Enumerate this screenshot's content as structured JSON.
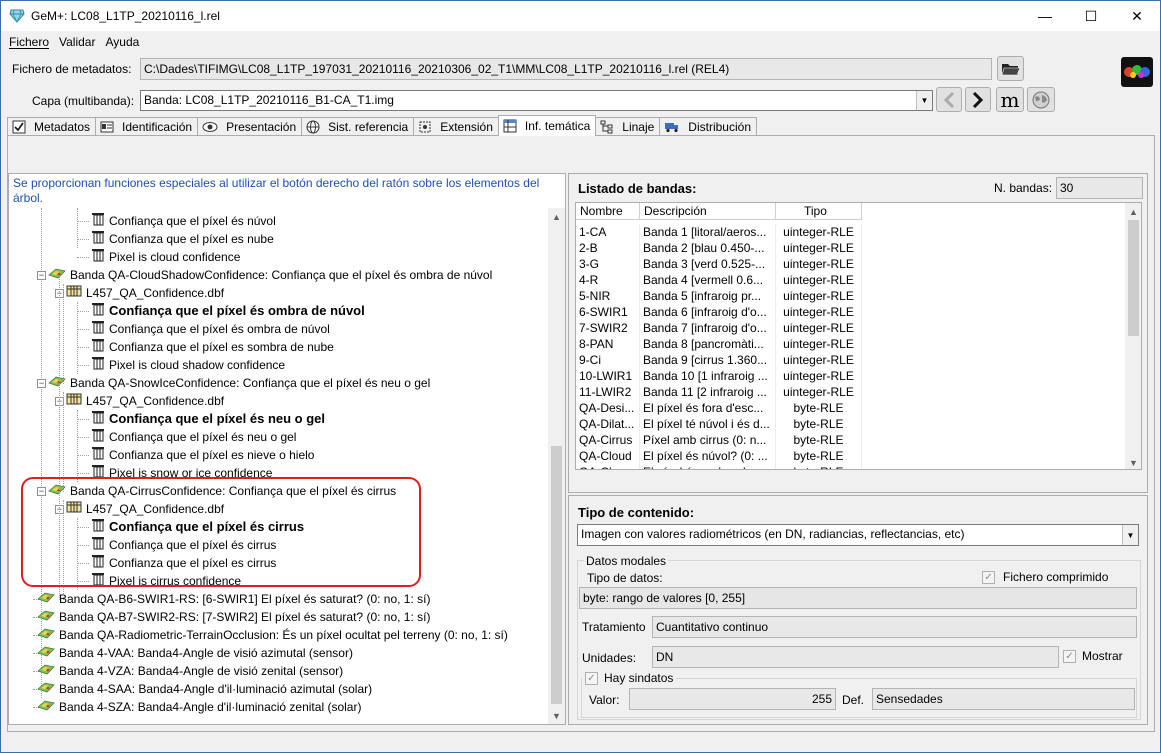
{
  "window": {
    "title": "GeM+: LC08_L1TP_20210116_l.rel",
    "minimize": "—",
    "maximize": "☐",
    "close": "✕"
  },
  "menu": [
    "Fichero",
    "Validar",
    "Ayuda"
  ],
  "metadata_file": {
    "label": "Fichero de metadatos:",
    "value": "C:\\Dades\\TIFIMG\\LC08_L1TP_197031_20210116_20210306_02_T1\\MM\\LC08_L1TP_20210116_l.rel (REL4)"
  },
  "layer": {
    "label": "Capa (multibanda):",
    "value": "Banda: LC08_L1TP_20210116_B1-CA_T1.img"
  },
  "tabs": [
    {
      "label": "Metadatos",
      "icon": "check-edit-icon"
    },
    {
      "label": "Identificación",
      "icon": "id-card-icon"
    },
    {
      "label": "Presentación",
      "icon": "eye-icon"
    },
    {
      "label": "Sist. referencia",
      "icon": "globe-icon"
    },
    {
      "label": "Extensión",
      "icon": "extent-icon"
    },
    {
      "label": "Inf. temática",
      "icon": "table-icon"
    },
    {
      "label": "Linaje",
      "icon": "tree-icon"
    },
    {
      "label": "Distribución",
      "icon": "truck-icon"
    }
  ],
  "tree": {
    "hint": "Se proporcionan funciones especiales al utilizar el botón derecho del ratón sobre los elementos del árbol.",
    "nodes": [
      {
        "text": "Confiança que el píxel és núvol",
        "level": 3,
        "bold": false
      },
      {
        "text": "Confianza que el píxel es nube",
        "level": 3,
        "bold": false
      },
      {
        "text": "Pixel is cloud confidence",
        "level": 3,
        "bold": false
      },
      {
        "text": "Banda QA-CloudShadowConfidence: Confiança que el píxel és ombra de núvol",
        "level": 1,
        "bold": false
      },
      {
        "text": "L457_QA_Confidence.dbf",
        "level": 2,
        "bold": false
      },
      {
        "text": "Confiança que el píxel és ombra de núvol",
        "level": 3,
        "bold": true
      },
      {
        "text": "Confiança que el píxel és ombra de núvol",
        "level": 3,
        "bold": false
      },
      {
        "text": "Confianza que el píxel es sombra de nube",
        "level": 3,
        "bold": false
      },
      {
        "text": "Pixel is cloud shadow confidence",
        "level": 3,
        "bold": false
      },
      {
        "text": "Banda QA-SnowIceConfidence: Confiança que el píxel és neu o gel",
        "level": 1,
        "bold": false
      },
      {
        "text": "L457_QA_Confidence.dbf",
        "level": 2,
        "bold": false
      },
      {
        "text": "Confiança que el píxel és neu o gel",
        "level": 3,
        "bold": true
      },
      {
        "text": "Confiança que el píxel és neu o gel",
        "level": 3,
        "bold": false
      },
      {
        "text": "Confianza que el píxel es nieve o hielo",
        "level": 3,
        "bold": false
      },
      {
        "text": "Pixel is snow or ice confidence",
        "level": 3,
        "bold": false
      },
      {
        "text": "Banda QA-CirrusConfidence: Confiança que el píxel és cirrus",
        "level": 1,
        "bold": false
      },
      {
        "text": "L457_QA_Confidence.dbf",
        "level": 2,
        "bold": false
      },
      {
        "text": "Confiança que el píxel és cirrus",
        "level": 3,
        "bold": true
      },
      {
        "text": "Confiança que el píxel és cirrus",
        "level": 3,
        "bold": false
      },
      {
        "text": "Confianza que el píxel es cirrus",
        "level": 3,
        "bold": false
      },
      {
        "text": "Pixel is cirrus confidence",
        "level": 3,
        "bold": false
      },
      {
        "text": "Banda QA-B6-SWIR1-RS: [6-SWIR1] El píxel és saturat? (0: no, 1: sí)",
        "level": 1,
        "bold": false
      },
      {
        "text": "Banda QA-B7-SWIR2-RS: [7-SWIR2] El píxel és saturat? (0: no, 1: sí)",
        "level": 1,
        "bold": false
      },
      {
        "text": "Banda QA-Radiometric-TerrainOcclusion: És un píxel ocultat pel terreny (0: no, 1: sí)",
        "level": 1,
        "bold": false
      },
      {
        "text": "Banda 4-VAA: Banda4-Angle de visió azimutal (sensor)",
        "level": 1,
        "bold": false
      },
      {
        "text": "Banda 4-VZA: Banda4-Angle de visió zenital (sensor)",
        "level": 1,
        "bold": false
      },
      {
        "text": "Banda 4-SAA: Banda4-Angle d'il·luminació azimutal (solar)",
        "level": 1,
        "bold": false
      },
      {
        "text": "Banda 4-SZA: Banda4-Angle d'il·luminació zenital (solar)",
        "level": 1,
        "bold": false
      }
    ]
  },
  "bands": {
    "title": "Listado de bandas:",
    "count_label": "N. bandas:",
    "count": "30",
    "headers": [
      "Nombre",
      "Descripción",
      "Tipo"
    ],
    "rows": [
      [
        "1-CA",
        "Banda 1 [litoral/aeros...",
        "uinteger-RLE"
      ],
      [
        "2-B",
        "Banda 2 [blau 0.450-...",
        "uinteger-RLE"
      ],
      [
        "3-G",
        "Banda 3 [verd 0.525-...",
        "uinteger-RLE"
      ],
      [
        "4-R",
        "Banda 4 [vermell 0.6...",
        "uinteger-RLE"
      ],
      [
        "5-NIR",
        "Banda 5 [infraroig pr...",
        "uinteger-RLE"
      ],
      [
        "6-SWIR1",
        "Banda 6 [infraroig d'o...",
        "uinteger-RLE"
      ],
      [
        "7-SWIR2",
        "Banda 7 [infraroig d'o...",
        "uinteger-RLE"
      ],
      [
        "8-PAN",
        "Banda 8 [pancromàti...",
        "uinteger-RLE"
      ],
      [
        "9-Ci",
        "Banda 9 [cirrus 1.360...",
        "uinteger-RLE"
      ],
      [
        "10-LWIR1",
        "Banda 10 [1 infraroig ...",
        "uinteger-RLE"
      ],
      [
        "11-LWIR2",
        "Banda 11 [2 infraroig ...",
        "uinteger-RLE"
      ],
      [
        "QA-Desi...",
        "El píxel és fora d'esc...",
        "byte-RLE"
      ],
      [
        "QA-Dilat...",
        "El píxel té núvol i és d...",
        "byte-RLE"
      ],
      [
        "QA-Cirrus",
        "Píxel amb cirrus (0: n...",
        "byte-RLE"
      ],
      [
        "QA-Cloud",
        "El píxel és núvol? (0: ...",
        "byte-RLE"
      ],
      [
        "QA-Clou...",
        "El píxel és ombra de...",
        "byte-RLE"
      ]
    ]
  },
  "content": {
    "title": "Tipo de contenido:",
    "type_value": "Imagen con valores radiométricos (en DN, radiancias, reflectancias, etc)",
    "modal_group": "Datos modales",
    "data_type_label": "Tipo de datos:",
    "compressed_label": "Fichero comprimido",
    "data_type_value": "byte: rango de valores [0, 255]",
    "treatment_label": "Tratamiento",
    "treatment_value": "Cuantitativo continuo",
    "units_label": "Unidades:",
    "units_value": "DN",
    "show_label": "Mostrar",
    "nodata_label": "Hay sindatos",
    "value_label": "Valor:",
    "value": "255",
    "def_label": "Def.",
    "def_value": "Sensedades"
  }
}
